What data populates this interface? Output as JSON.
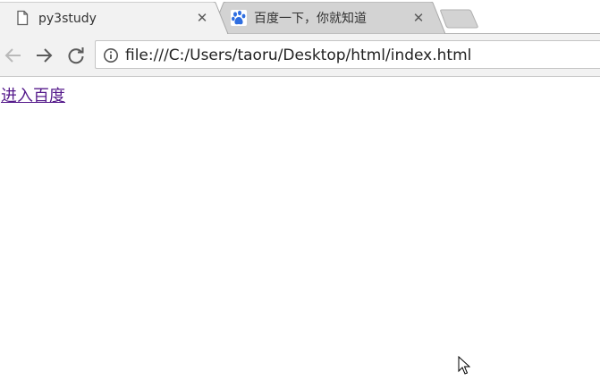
{
  "tabs": [
    {
      "title": "py3study",
      "icon": "page-icon",
      "active": true
    },
    {
      "title": "百度一下，你就知道",
      "icon": "baidu-paw-icon",
      "active": false
    }
  ],
  "toolbar": {
    "url": "file:///C:/Users/taoru/Desktop/html/index.html"
  },
  "content": {
    "link_text": "进入百度"
  },
  "colors": {
    "link": "#551a8b",
    "toolbar_bg": "#f2f2f2",
    "inactive_tab": "#d3d3d3",
    "baidu_blue": "#2f6ee0"
  }
}
